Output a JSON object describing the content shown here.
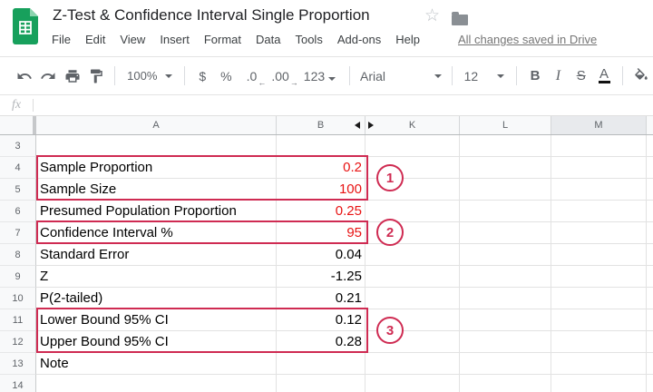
{
  "header": {
    "title": "Z-Test & Confidence Interval Single Proportion",
    "menu": [
      "File",
      "Edit",
      "View",
      "Insert",
      "Format",
      "Data",
      "Tools",
      "Add-ons",
      "Help"
    ],
    "save_status": "All changes saved in Drive"
  },
  "toolbar": {
    "zoom_value": "100%",
    "currency": "$",
    "percent": "%",
    "decrease_decimal": ".0",
    "increase_decimal": ".00",
    "number_format": "123",
    "font_name": "Arial",
    "font_size": "12",
    "bold": "B",
    "italic": "I",
    "strikethrough": "S",
    "text_color": "A"
  },
  "formula_bar": {
    "fx_label": "fx",
    "value": ""
  },
  "sheet": {
    "column_headers": [
      "A",
      "B",
      "K",
      "L",
      "M"
    ],
    "selected_column": "M",
    "hidden_columns_between": [
      "B",
      "K"
    ],
    "rows": [
      {
        "num": "3",
        "label": "",
        "value": ""
      },
      {
        "num": "4",
        "label": "Sample Proportion",
        "value": "0.2",
        "value_red": true
      },
      {
        "num": "5",
        "label": "Sample Size",
        "value": "100",
        "value_red": true
      },
      {
        "num": "6",
        "label": "Presumed Population Proportion",
        "value": "0.25",
        "value_red": true
      },
      {
        "num": "7",
        "label": "Confidence Interval %",
        "value": "95",
        "value_red": true
      },
      {
        "num": "8",
        "label": "Standard Error",
        "value": "0.04"
      },
      {
        "num": "9",
        "label": "Z",
        "value": "-1.25"
      },
      {
        "num": "10",
        "label": "P(2-tailed)",
        "value": "0.21"
      },
      {
        "num": "11",
        "label": "Lower Bound 95% CI",
        "value": "0.12"
      },
      {
        "num": "12",
        "label": "Upper Bound 95% CI",
        "value": "0.28"
      },
      {
        "num": "13",
        "label": "Note",
        "value": ""
      },
      {
        "num": "14",
        "label": "",
        "value": ""
      }
    ]
  },
  "annotations": [
    {
      "number": "1",
      "covers": "rows 4-5"
    },
    {
      "number": "2",
      "covers": "row 7"
    },
    {
      "number": "3",
      "covers": "rows 11-12"
    }
  ],
  "colors": {
    "annotation_red": "#cf2b52",
    "red_value_text": "#e81313",
    "toolbar_icon": "#5f6368",
    "logo_green": "#17a05c",
    "selected_column_header_bg": "#e8eaed",
    "header_bg": "#f8f9fa",
    "grid_line": "#e2e2e2"
  }
}
